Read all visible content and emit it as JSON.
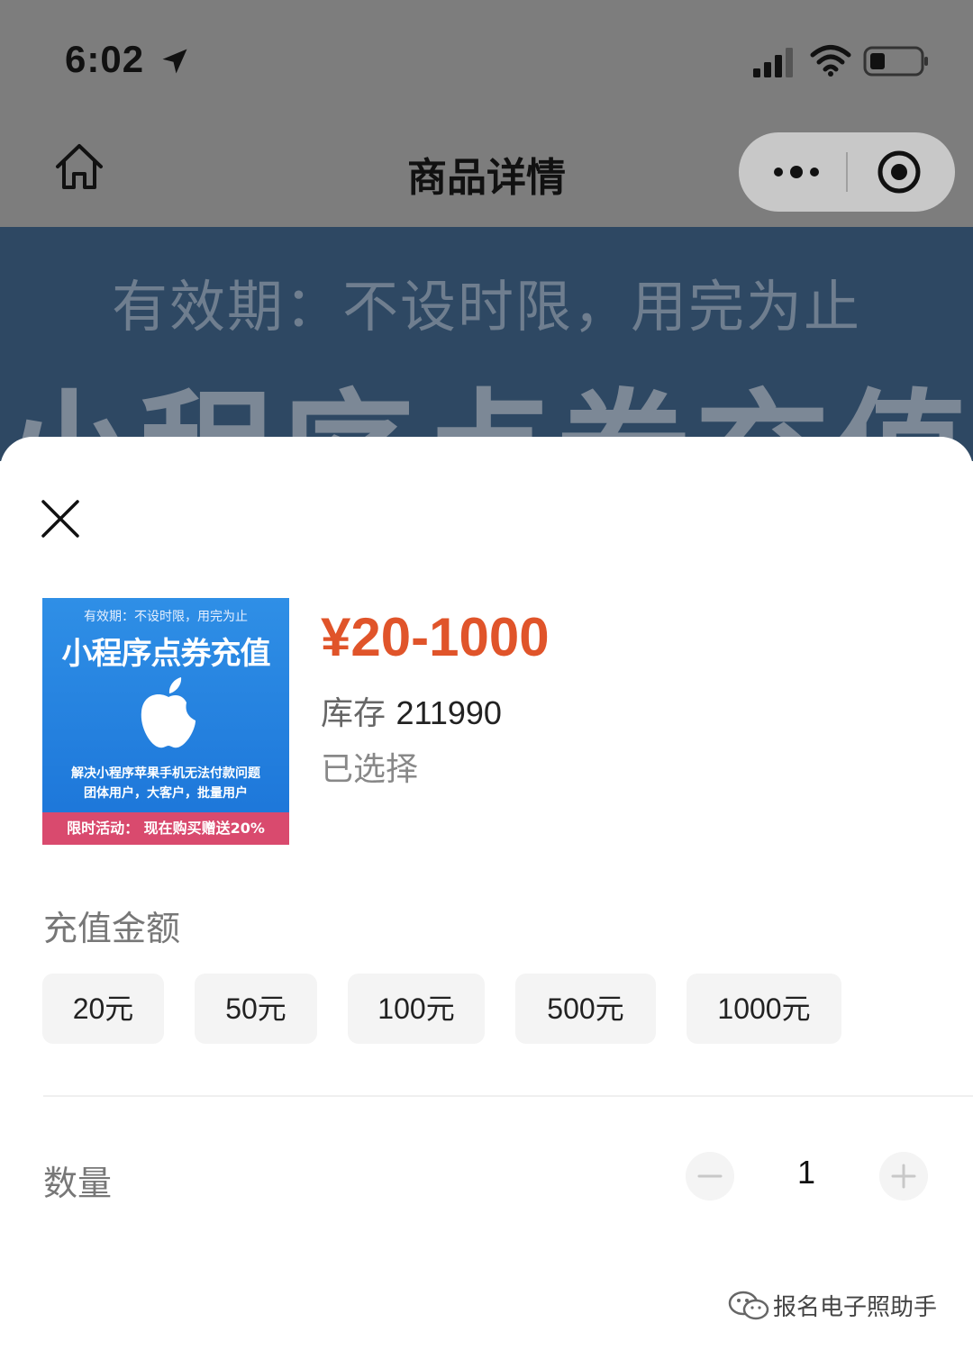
{
  "status_bar": {
    "time": "6:02"
  },
  "nav": {
    "title": "商品详情"
  },
  "banner": {
    "subtitle": "有效期：不设时限，用完为止",
    "title": "小程序点券充值"
  },
  "product": {
    "thumbnail": {
      "subtitle": "有效期：不设时限，用完为止",
      "title": "小程序点券充值",
      "line1": "解决小程序苹果手机无法付款问题",
      "line2": "团体用户，大客户，批量用户",
      "promo": "限时活动：  现在购买赠送20%"
    },
    "price": "¥20-1000",
    "stock_label": "库存",
    "stock_value": "211990",
    "selected_label": "已选择"
  },
  "amount_section": {
    "label": "充值金额",
    "options": [
      "20元",
      "50元",
      "100元",
      "500元",
      "1000元"
    ]
  },
  "quantity": {
    "label": "数量",
    "value": "1",
    "decrement": "−",
    "increment": "+"
  },
  "watermark": {
    "text": "报名电子照助手"
  },
  "colors": {
    "price": "#e0542a",
    "overlay": "#7d7d7d",
    "chip_bg": "#f4f4f4",
    "thumbnail_blue": "#1b74d8",
    "promo_pink": "#d94a6e"
  }
}
